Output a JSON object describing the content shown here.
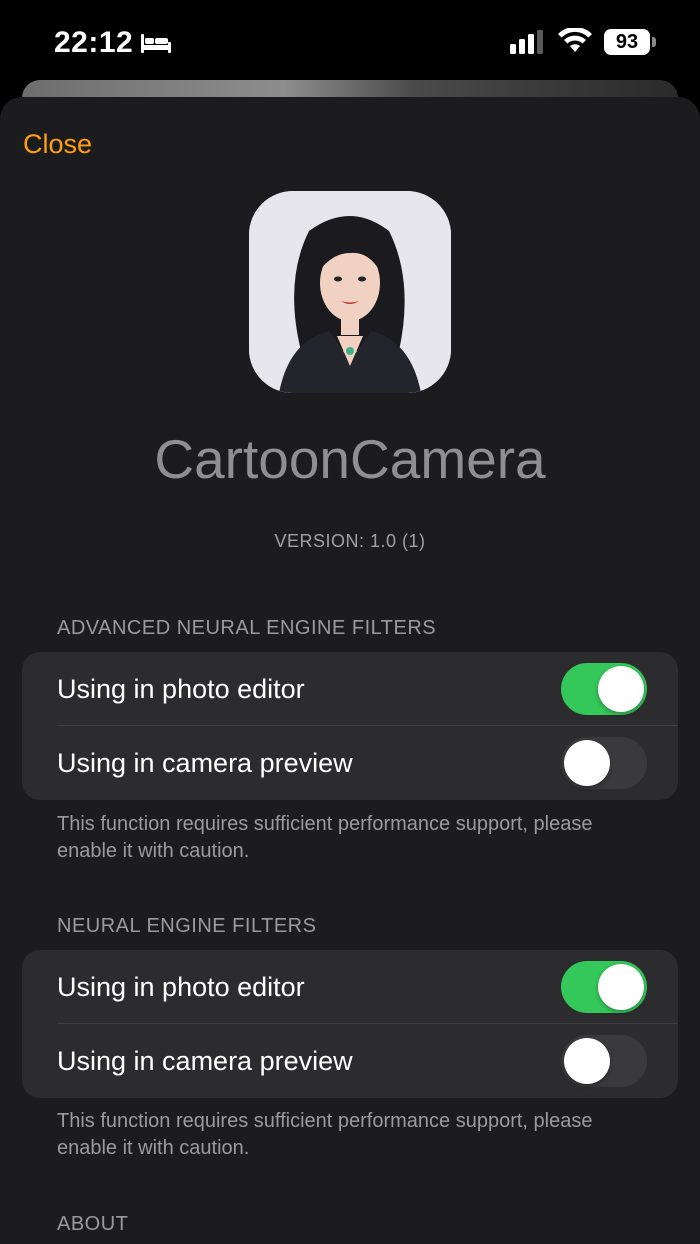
{
  "status_bar": {
    "time": "22:12",
    "battery": "93",
    "icons": [
      "bed-icon",
      "signal-icon",
      "wifi-icon",
      "battery-icon"
    ]
  },
  "header": {
    "close_label": "Close",
    "accent_color": "#ff9f0a"
  },
  "app": {
    "name": "CartoonCamera",
    "version": "VERSION: 1.0 (1)"
  },
  "sections": [
    {
      "title": "ADVANCED NEURAL ENGINE FILTERS",
      "rows": [
        {
          "label": "Using in photo editor",
          "enabled": true
        },
        {
          "label": "Using in camera preview",
          "enabled": false
        }
      ],
      "footer": "This function requires sufficient performance support, please enable it with caution."
    },
    {
      "title": "NEURAL ENGINE FILTERS",
      "rows": [
        {
          "label": "Using in photo editor",
          "enabled": true
        },
        {
          "label": "Using in camera preview",
          "enabled": false
        }
      ],
      "footer": "This function requires sufficient performance support, please enable it with caution."
    },
    {
      "title": "ABOUT"
    }
  ],
  "colors": {
    "toggle_on": "#34c759",
    "toggle_off": "#3a3a3c",
    "background": "#1c1c1e",
    "group": "#2c2c2e"
  }
}
